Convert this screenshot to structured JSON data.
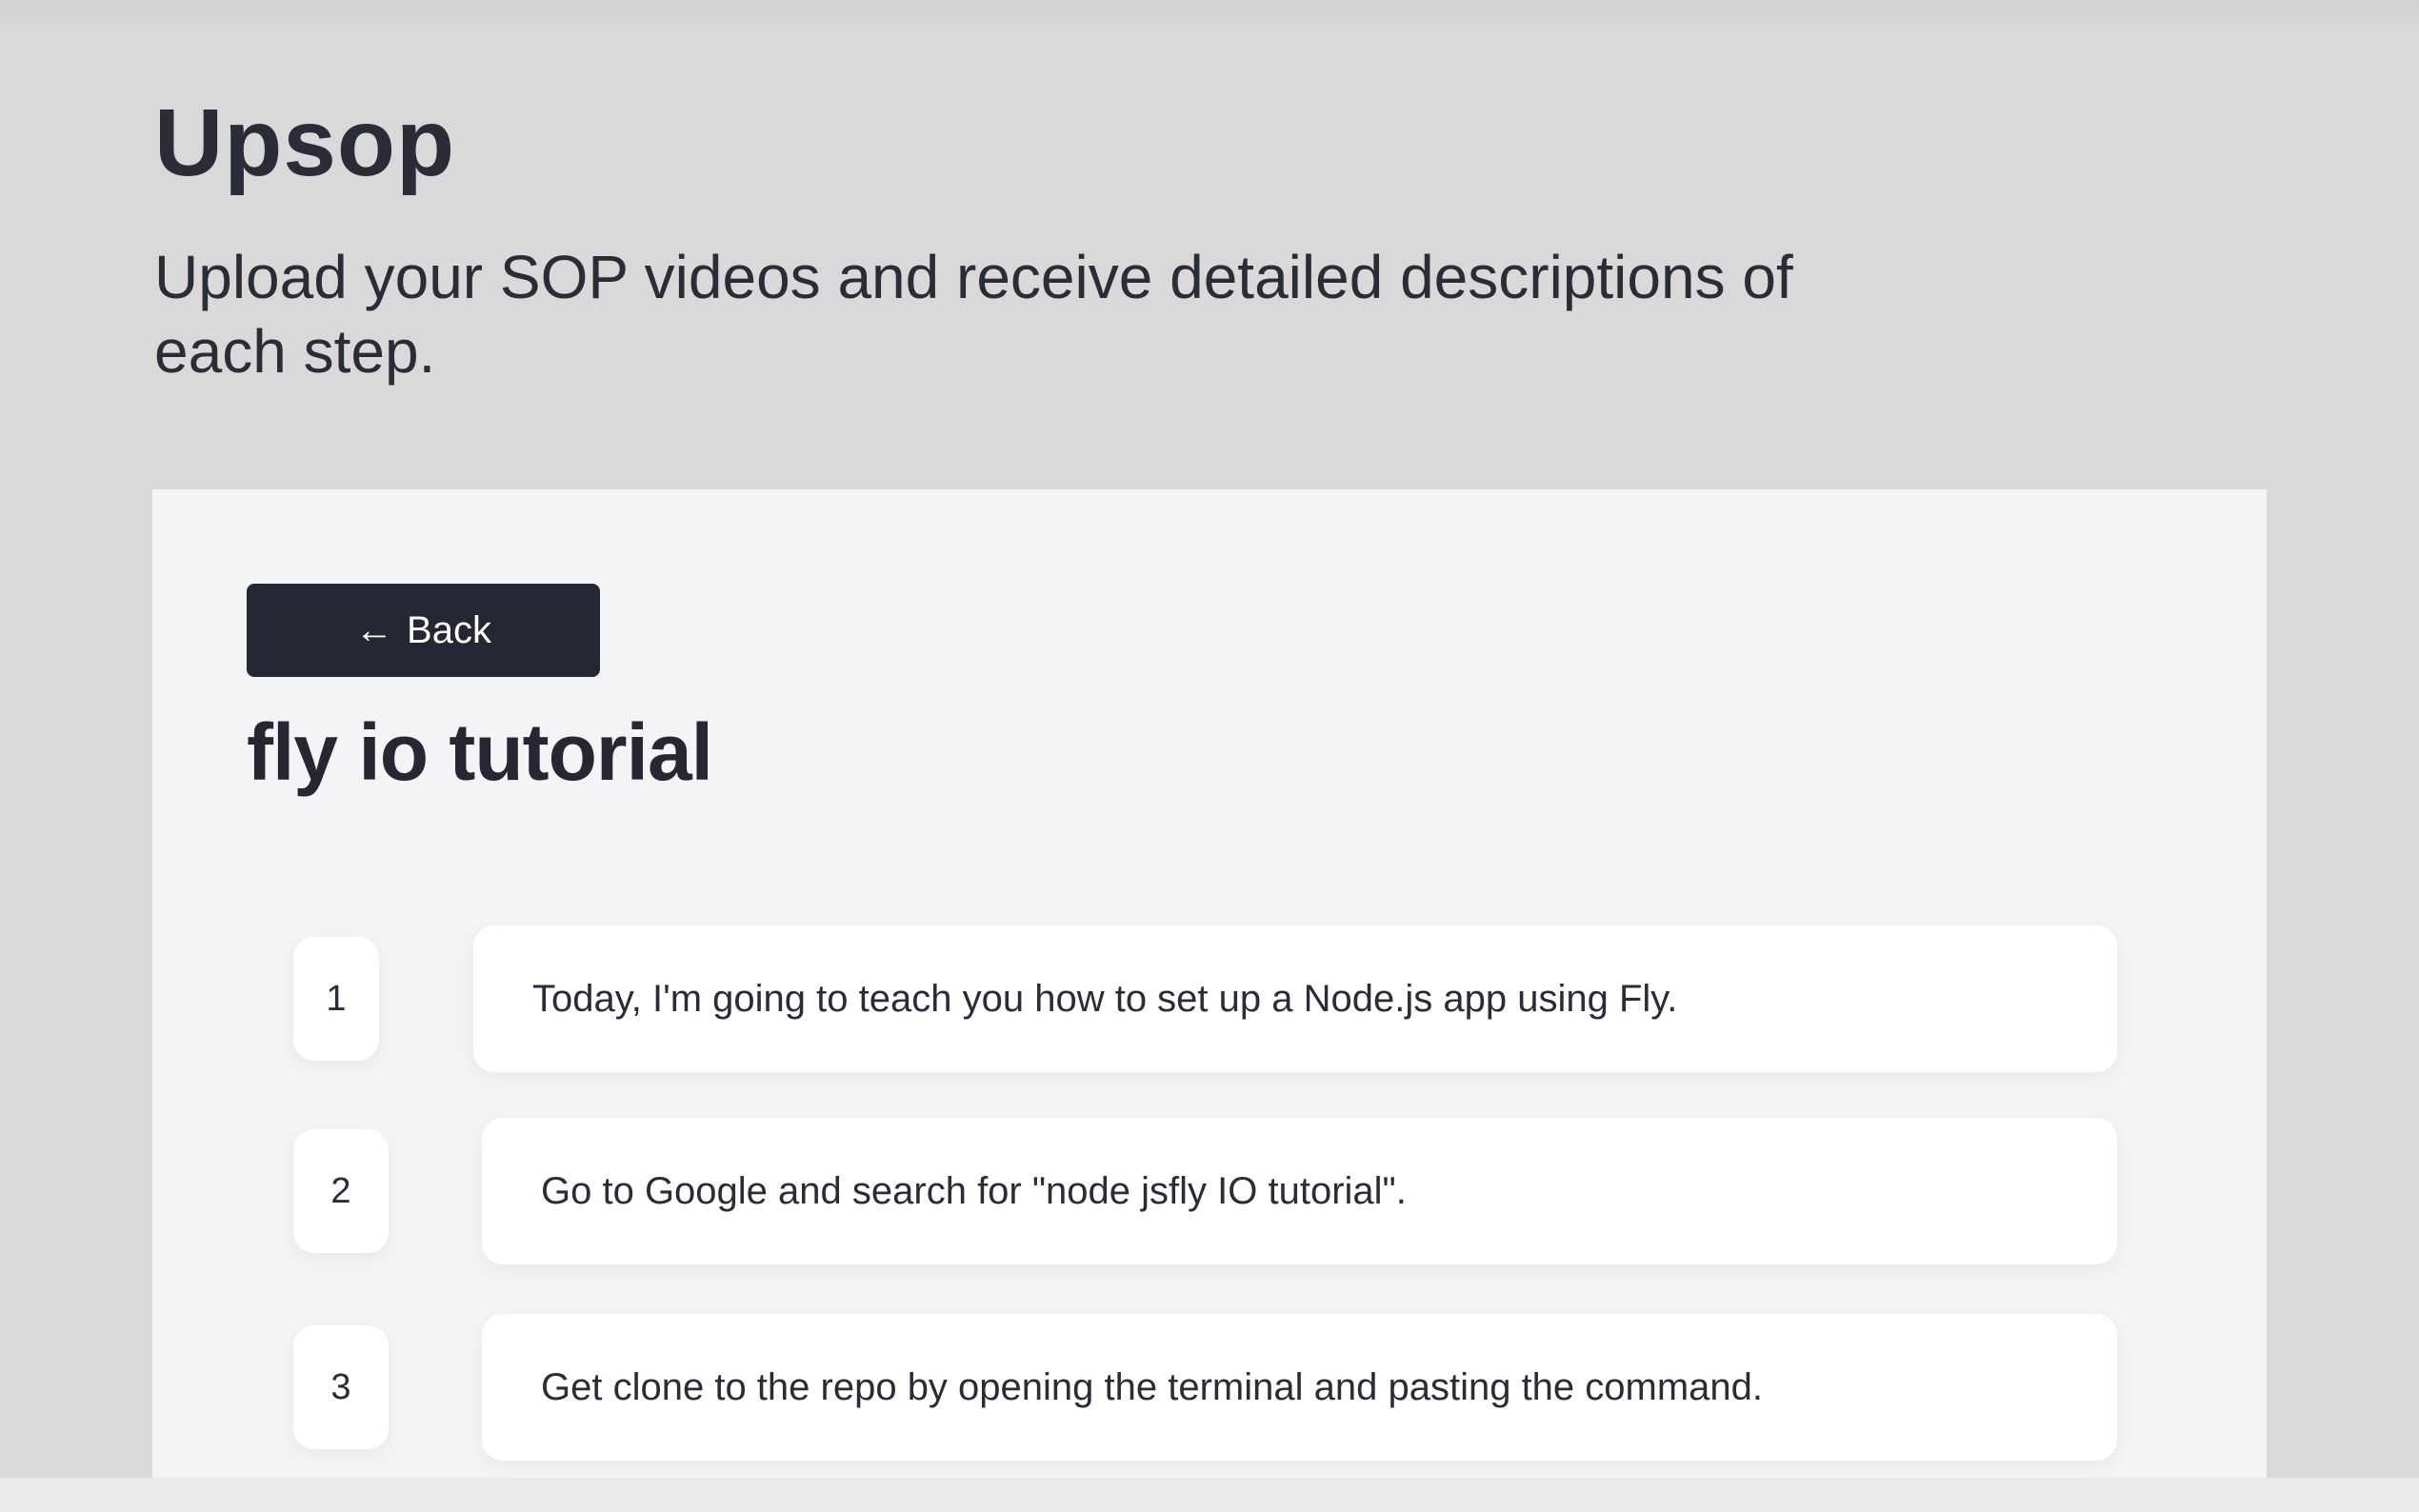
{
  "app": {
    "title": "Upsop",
    "subtitle": "Upload your SOP videos and receive detailed descriptions of each step."
  },
  "panel": {
    "back_label": "Back",
    "back_icon": "arrow-left-icon",
    "doc_title": "fly io tutorial",
    "steps": [
      {
        "number": "1",
        "text": "Today, I'm going to teach you how to set up a Node.js app using Fly."
      },
      {
        "number": "2",
        "text": "Go to Google and search for \"node jsfly IO tutorial\"."
      },
      {
        "number": "3",
        "text": "Get clone to the repo by opening the terminal and pasting the command."
      }
    ]
  },
  "colors": {
    "background": "#d9d9d9",
    "panel": "#f3f4f6",
    "button": "#262734",
    "text": "#2a2c37",
    "card": "#ffffff"
  }
}
